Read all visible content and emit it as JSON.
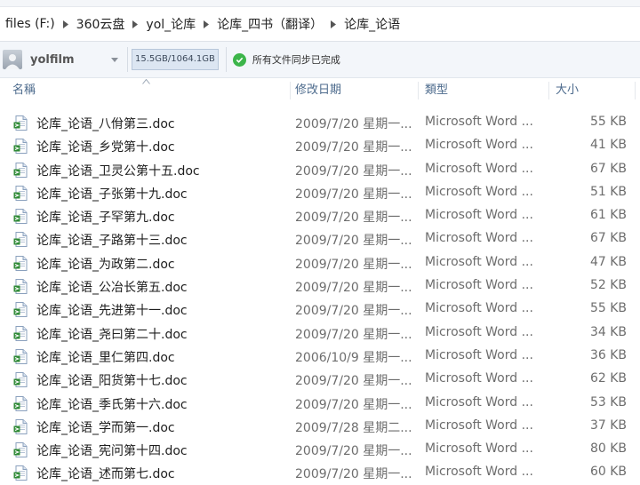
{
  "breadcrumb": [
    "files (F:)",
    "360云盘",
    "yol_论库",
    "论库_四书（翻译）",
    "论库_论语"
  ],
  "account": {
    "name": "yolfilm",
    "quota": "15.5GB/1064.1GB",
    "sync_status": "所有文件同步已完成"
  },
  "columns": {
    "name": "名稱",
    "date": "修改日期",
    "type": "類型",
    "size": "大小"
  },
  "files": [
    {
      "name": "论库_论语_八佾第三.doc",
      "date": "2009/7/20 星期一...",
      "type": "Microsoft Word ...",
      "size": "55 KB"
    },
    {
      "name": "论库_论语_乡党第十.doc",
      "date": "2009/7/20 星期一...",
      "type": "Microsoft Word ...",
      "size": "41 KB"
    },
    {
      "name": "论库_论语_卫灵公第十五.doc",
      "date": "2009/7/20 星期一...",
      "type": "Microsoft Word ...",
      "size": "67 KB"
    },
    {
      "name": "论库_论语_子张第十九.doc",
      "date": "2009/7/20 星期一...",
      "type": "Microsoft Word ...",
      "size": "51 KB"
    },
    {
      "name": "论库_论语_子罕第九.doc",
      "date": "2009/7/20 星期一...",
      "type": "Microsoft Word ...",
      "size": "61 KB"
    },
    {
      "name": "论库_论语_子路第十三.doc",
      "date": "2009/7/20 星期一...",
      "type": "Microsoft Word ...",
      "size": "67 KB"
    },
    {
      "name": "论库_论语_为政第二.doc",
      "date": "2009/7/20 星期一...",
      "type": "Microsoft Word ...",
      "size": "47 KB"
    },
    {
      "name": "论库_论语_公冶长第五.doc",
      "date": "2009/7/20 星期一...",
      "type": "Microsoft Word ...",
      "size": "52 KB"
    },
    {
      "name": "论库_论语_先进第十一.doc",
      "date": "2009/7/20 星期一...",
      "type": "Microsoft Word ...",
      "size": "55 KB"
    },
    {
      "name": "论库_论语_尧曰第二十.doc",
      "date": "2009/7/20 星期一...",
      "type": "Microsoft Word ...",
      "size": "34 KB"
    },
    {
      "name": "论库_论语_里仁第四.doc",
      "date": "2006/10/9 星期一...",
      "type": "Microsoft Word ...",
      "size": "36 KB"
    },
    {
      "name": "论库_论语_阳货第十七.doc",
      "date": "2009/7/20 星期一...",
      "type": "Microsoft Word ...",
      "size": "62 KB"
    },
    {
      "name": "论库_论语_季氏第十六.doc",
      "date": "2009/7/20 星期一...",
      "type": "Microsoft Word ...",
      "size": "53 KB"
    },
    {
      "name": "论库_论语_学而第一.doc",
      "date": "2009/7/28 星期二...",
      "type": "Microsoft Word ...",
      "size": "37 KB"
    },
    {
      "name": "论库_论语_宪问第十四.doc",
      "date": "2009/7/20 星期一...",
      "type": "Microsoft Word ...",
      "size": "80 KB"
    },
    {
      "name": "论库_论语_述而第七.doc",
      "date": "2009/7/20 星期一...",
      "type": "Microsoft Word ...",
      "size": "60 KB"
    }
  ]
}
